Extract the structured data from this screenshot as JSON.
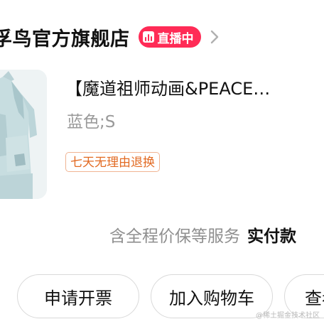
{
  "store": {
    "name": "孚鸟官方旗舰店",
    "live_label": "直播中"
  },
  "product": {
    "title": "【魔道祖师动画&PEACE…",
    "variant": "蓝色;S",
    "return_policy": "七天无理由退换"
  },
  "service": {
    "text": "含全程价保等服务",
    "payment_label": "实付款"
  },
  "actions": {
    "invoice_label": "申请开票",
    "cart_label": "加入购物车",
    "more_label": "查看"
  },
  "watermark": "@稀土掘金技术社区",
  "colors": {
    "live_badge": "#ff2b56",
    "return_tag_text": "#e26a22",
    "return_tag_border": "#f0b493",
    "muted_text": "#9a9a9a"
  },
  "icons": {
    "live": "live-bars-icon",
    "store_arrow": "chevron-right-icon"
  }
}
